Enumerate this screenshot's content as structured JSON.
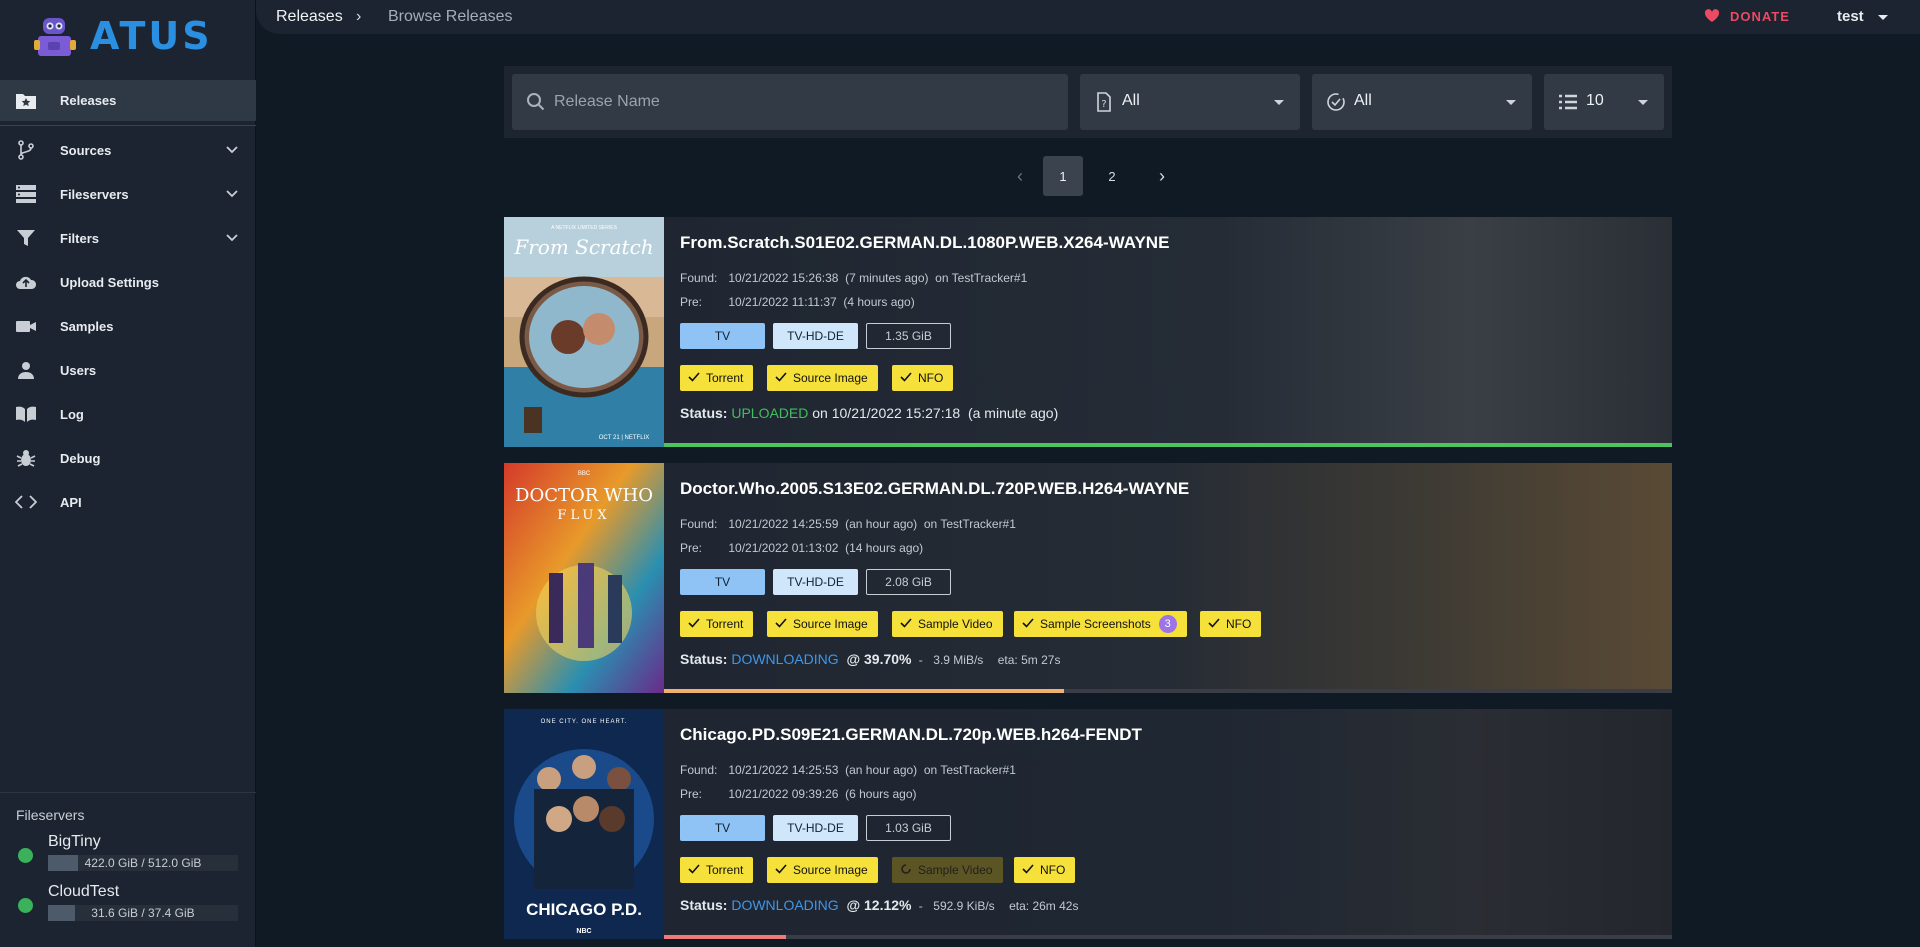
{
  "app": {
    "logo_text": "ATUS"
  },
  "header": {
    "breadcrumb_root": "Releases",
    "breadcrumb_current": "Browse Releases",
    "donate_label": "DONATE",
    "user_name": "test"
  },
  "sidebar": {
    "items": [
      {
        "label": "Releases",
        "icon": "star-folder-icon"
      },
      {
        "label": "Sources",
        "icon": "branch-icon"
      },
      {
        "label": "Fileservers",
        "icon": "server-icon"
      },
      {
        "label": "Filters",
        "icon": "funnel-icon"
      },
      {
        "label": "Upload Settings",
        "icon": "cloud-upload-icon"
      },
      {
        "label": "Samples",
        "icon": "video-camera-icon"
      },
      {
        "label": "Users",
        "icon": "user-icon"
      },
      {
        "label": "Log",
        "icon": "book-icon"
      },
      {
        "label": "Debug",
        "icon": "bug-icon"
      },
      {
        "label": "API",
        "icon": "code-icon"
      }
    ],
    "fileservers_title": "Fileservers",
    "fileservers": [
      {
        "name": "BigTiny",
        "usage": "422.0 GiB / 512.0 GiB",
        "used_fraction": 0.16,
        "status_color": "#3bb15b"
      },
      {
        "name": "CloudTest",
        "usage": "31.6 GiB / 37.4 GiB",
        "used_fraction": 0.14,
        "status_color": "#3bb15b"
      }
    ]
  },
  "filters": {
    "search_placeholder": "Release Name",
    "category_value": "All",
    "status_value": "All",
    "per_page_value": "10"
  },
  "pagination": {
    "prev": "‹",
    "pages": [
      "1",
      "2"
    ],
    "next": "›",
    "current": "1"
  },
  "labels": {
    "found": "Found:",
    "pre": "Pre:",
    "status": "Status:",
    "on": "on"
  },
  "releases": [
    {
      "title": "From.Scratch.S01E02.GERMAN.DL.1080P.WEB.X264-WAYNE",
      "found": "10/21/2022 15:26:38",
      "found_rel": "(7 minutes ago)",
      "tracker": "TestTracker#1",
      "pre": "10/21/2022 11:11:37",
      "pre_rel": "(4 hours ago)",
      "cat": "TV",
      "sub": "TV-HD-DE",
      "size": "1.35 GiB",
      "checks": [
        "Torrent",
        "Source Image",
        "NFO"
      ],
      "status_word": "UPLOADED",
      "status_tail": "on 10/21/2022 15:27:18",
      "status_rel": "(a minute ago)",
      "progress": 1.0,
      "progress_color": "#4cc561"
    },
    {
      "title": "Doctor.Who.2005.S13E02.GERMAN.DL.720P.WEB.H264-WAYNE",
      "found": "10/21/2022 14:25:59",
      "found_rel": "(an hour ago)",
      "tracker": "TestTracker#1",
      "pre": "10/21/2022 01:13:02",
      "pre_rel": "(14 hours ago)",
      "cat": "TV",
      "sub": "TV-HD-DE",
      "size": "2.08 GiB",
      "checks": [
        "Torrent",
        "Source Image",
        "Sample Video",
        "Sample Screenshots",
        "NFO"
      ],
      "screenshots_count": "3",
      "status_word": "DOWNLOADING",
      "status_pct": "@ 39.70%",
      "speed": "3.9 MiB/s",
      "eta": "eta: 5m 27s",
      "progress": 0.397,
      "progress_color": "#f0b070"
    },
    {
      "title": "Chicago.PD.S09E21.GERMAN.DL.720p.WEB.h264-FENDT",
      "found": "10/21/2022 14:25:53",
      "found_rel": "(an hour ago)",
      "tracker": "TestTracker#1",
      "pre": "10/21/2022 09:39:26",
      "pre_rel": "(6 hours ago)",
      "cat": "TV",
      "sub": "TV-HD-DE",
      "size": "1.03 GiB",
      "checks": [
        "Torrent",
        "Source Image",
        "Sample Video",
        "NFO"
      ],
      "status_word": "DOWNLOADING",
      "status_pct": "@ 12.12%",
      "speed": "592.9 KiB/s",
      "eta": "eta: 26m 42s",
      "progress": 0.1212,
      "progress_color": "#f07a7a"
    }
  ],
  "posters": [
    {
      "top_text": "A NETFLIX LIMITED SERIES",
      "title_text": "From Scratch",
      "bottom_text": "OCT 21 | NETFLIX"
    },
    {
      "top_text": "BBC",
      "title_text": "DOCTOR WHO",
      "sub_text": "FLUX"
    },
    {
      "top_text": "ONE CITY. ONE HEART.",
      "title_text": "CHICAGO P.D.",
      "bottom_text": "NBC"
    }
  ]
}
